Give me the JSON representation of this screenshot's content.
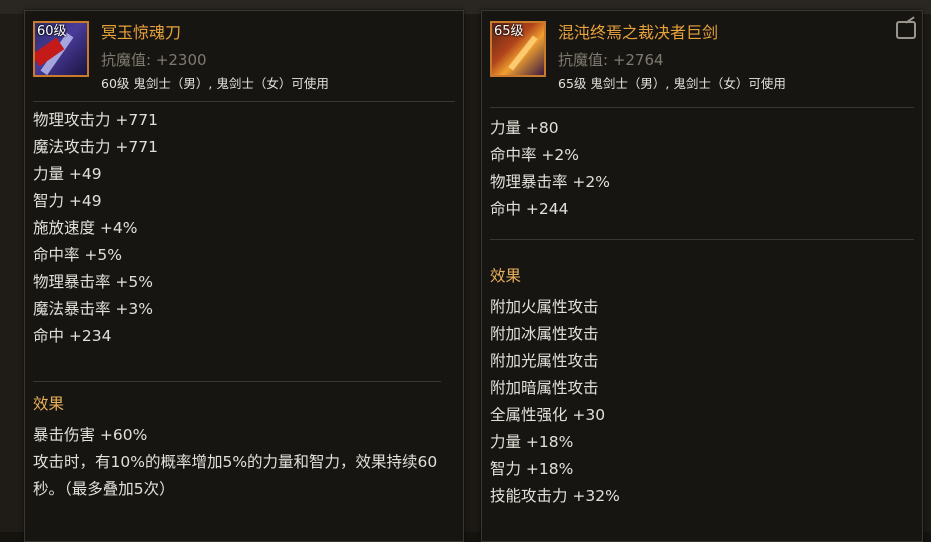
{
  "tooltip_left": {
    "item": {
      "level_badge": "60级",
      "name": "冥玉惊魂刀",
      "magic_resistance": "抗魔值: +2300",
      "usable_by": "60级 鬼剑士（男）, 鬼剑士（女）可使用"
    },
    "stats": [
      "物理攻击力 +771",
      "魔法攻击力 +771",
      "力量 +49",
      "智力 +49",
      "施放速度 +4%",
      "命中率 +5%",
      "物理暴击率 +5%",
      "魔法暴击率 +3%",
      "命中 +234"
    ],
    "effect_title": "效果",
    "effects": [
      "暴击伤害 +60%",
      "攻击时，有10%的概率增加5%的力量和智力，效果持续60秒。（最多叠加5次）"
    ]
  },
  "tooltip_right": {
    "item": {
      "level_badge": "65级",
      "name": "混沌终焉之裁决者巨剑",
      "magic_resistance": "抗魔值: +2764",
      "usable_by": "65级 鬼剑士（男）, 鬼剑士（女）可使用"
    },
    "stats": [
      "力量 +80",
      "命中率 +2%",
      "物理暴击率 +2%",
      "命中 +244"
    ],
    "effect_title": "效果",
    "effects": [
      "附加火属性攻击",
      "附加冰属性攻击",
      "附加光属性攻击",
      "附加暗属性攻击",
      "全属性强化 +30",
      "力量 +18%",
      "智力 +18%",
      "技能攻击力 +32%"
    ]
  },
  "colors": {
    "item_name": "#e8a23a",
    "section_title": "#e8b05a",
    "stat_text": "#e2dfd8",
    "muted_text": "#7f7a70",
    "icon_border": "#c97a2a"
  }
}
